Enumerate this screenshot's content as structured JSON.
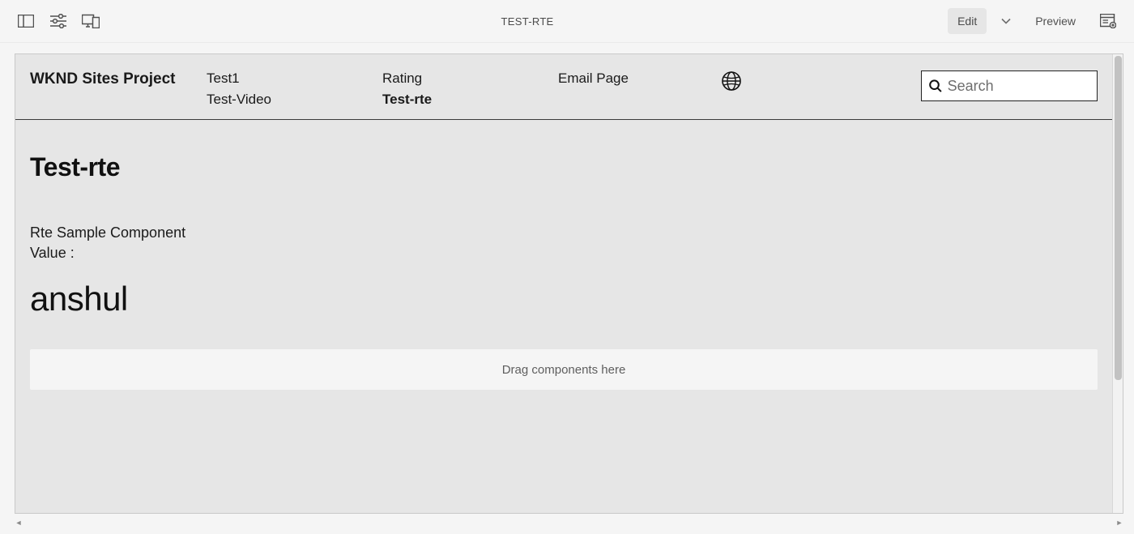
{
  "appbar": {
    "title": "TEST-RTE",
    "mode_edit": "Edit",
    "mode_preview": "Preview"
  },
  "site": {
    "brand": "WKND Sites Project",
    "nav": {
      "col1": [
        "Test1",
        "Test-Video"
      ],
      "col2": [
        "Rating",
        "Test-rte"
      ],
      "col3": [
        "Email Page"
      ]
    },
    "active_nav": "Test-rte",
    "search_placeholder": "Search"
  },
  "page": {
    "heading": "Test-rte",
    "component": {
      "title": "Rte Sample Component",
      "value_label": "Value :",
      "value": "anshul"
    },
    "dropzone_text": "Drag components here"
  }
}
